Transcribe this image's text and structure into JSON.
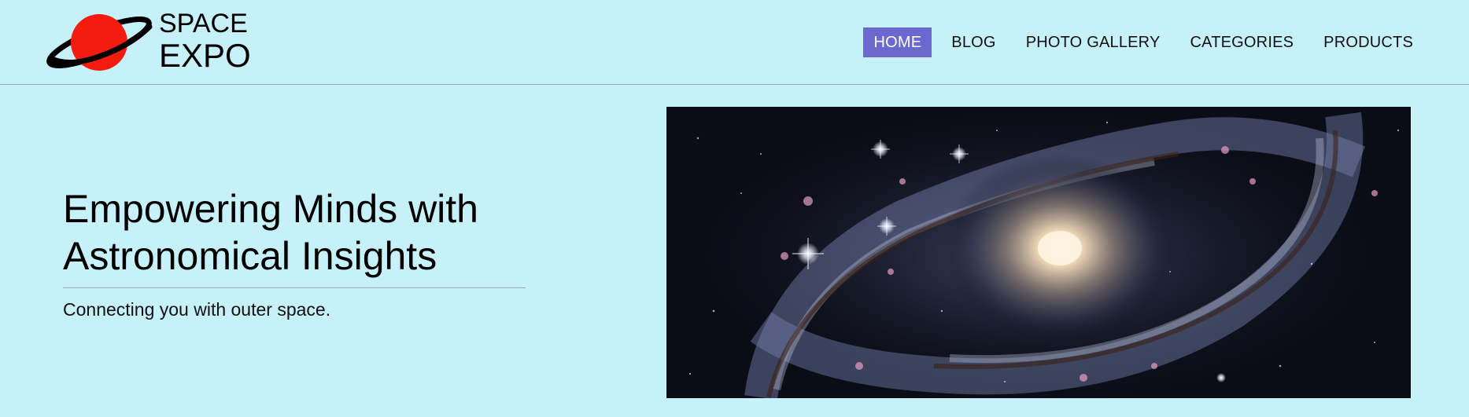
{
  "brand": {
    "line1": "SPACE",
    "line2": "EXPO",
    "planet_color": "#f41b0f",
    "ring_color": "#000000",
    "icon": "planet-logo-icon"
  },
  "nav": {
    "active_color": "#6b68cf",
    "items": [
      {
        "label": "HOME",
        "active": true
      },
      {
        "label": "BLOG",
        "active": false
      },
      {
        "label": "PHOTO GALLERY",
        "active": false
      },
      {
        "label": "CATEGORIES",
        "active": false
      },
      {
        "label": "PRODUCTS",
        "active": false
      }
    ]
  },
  "hero": {
    "title": "Empowering Minds with Astronomical Insights",
    "subtitle": "Connecting you with outer space.",
    "image": "spiral-galaxy-image"
  },
  "colors": {
    "background": "#c6f1f8"
  }
}
